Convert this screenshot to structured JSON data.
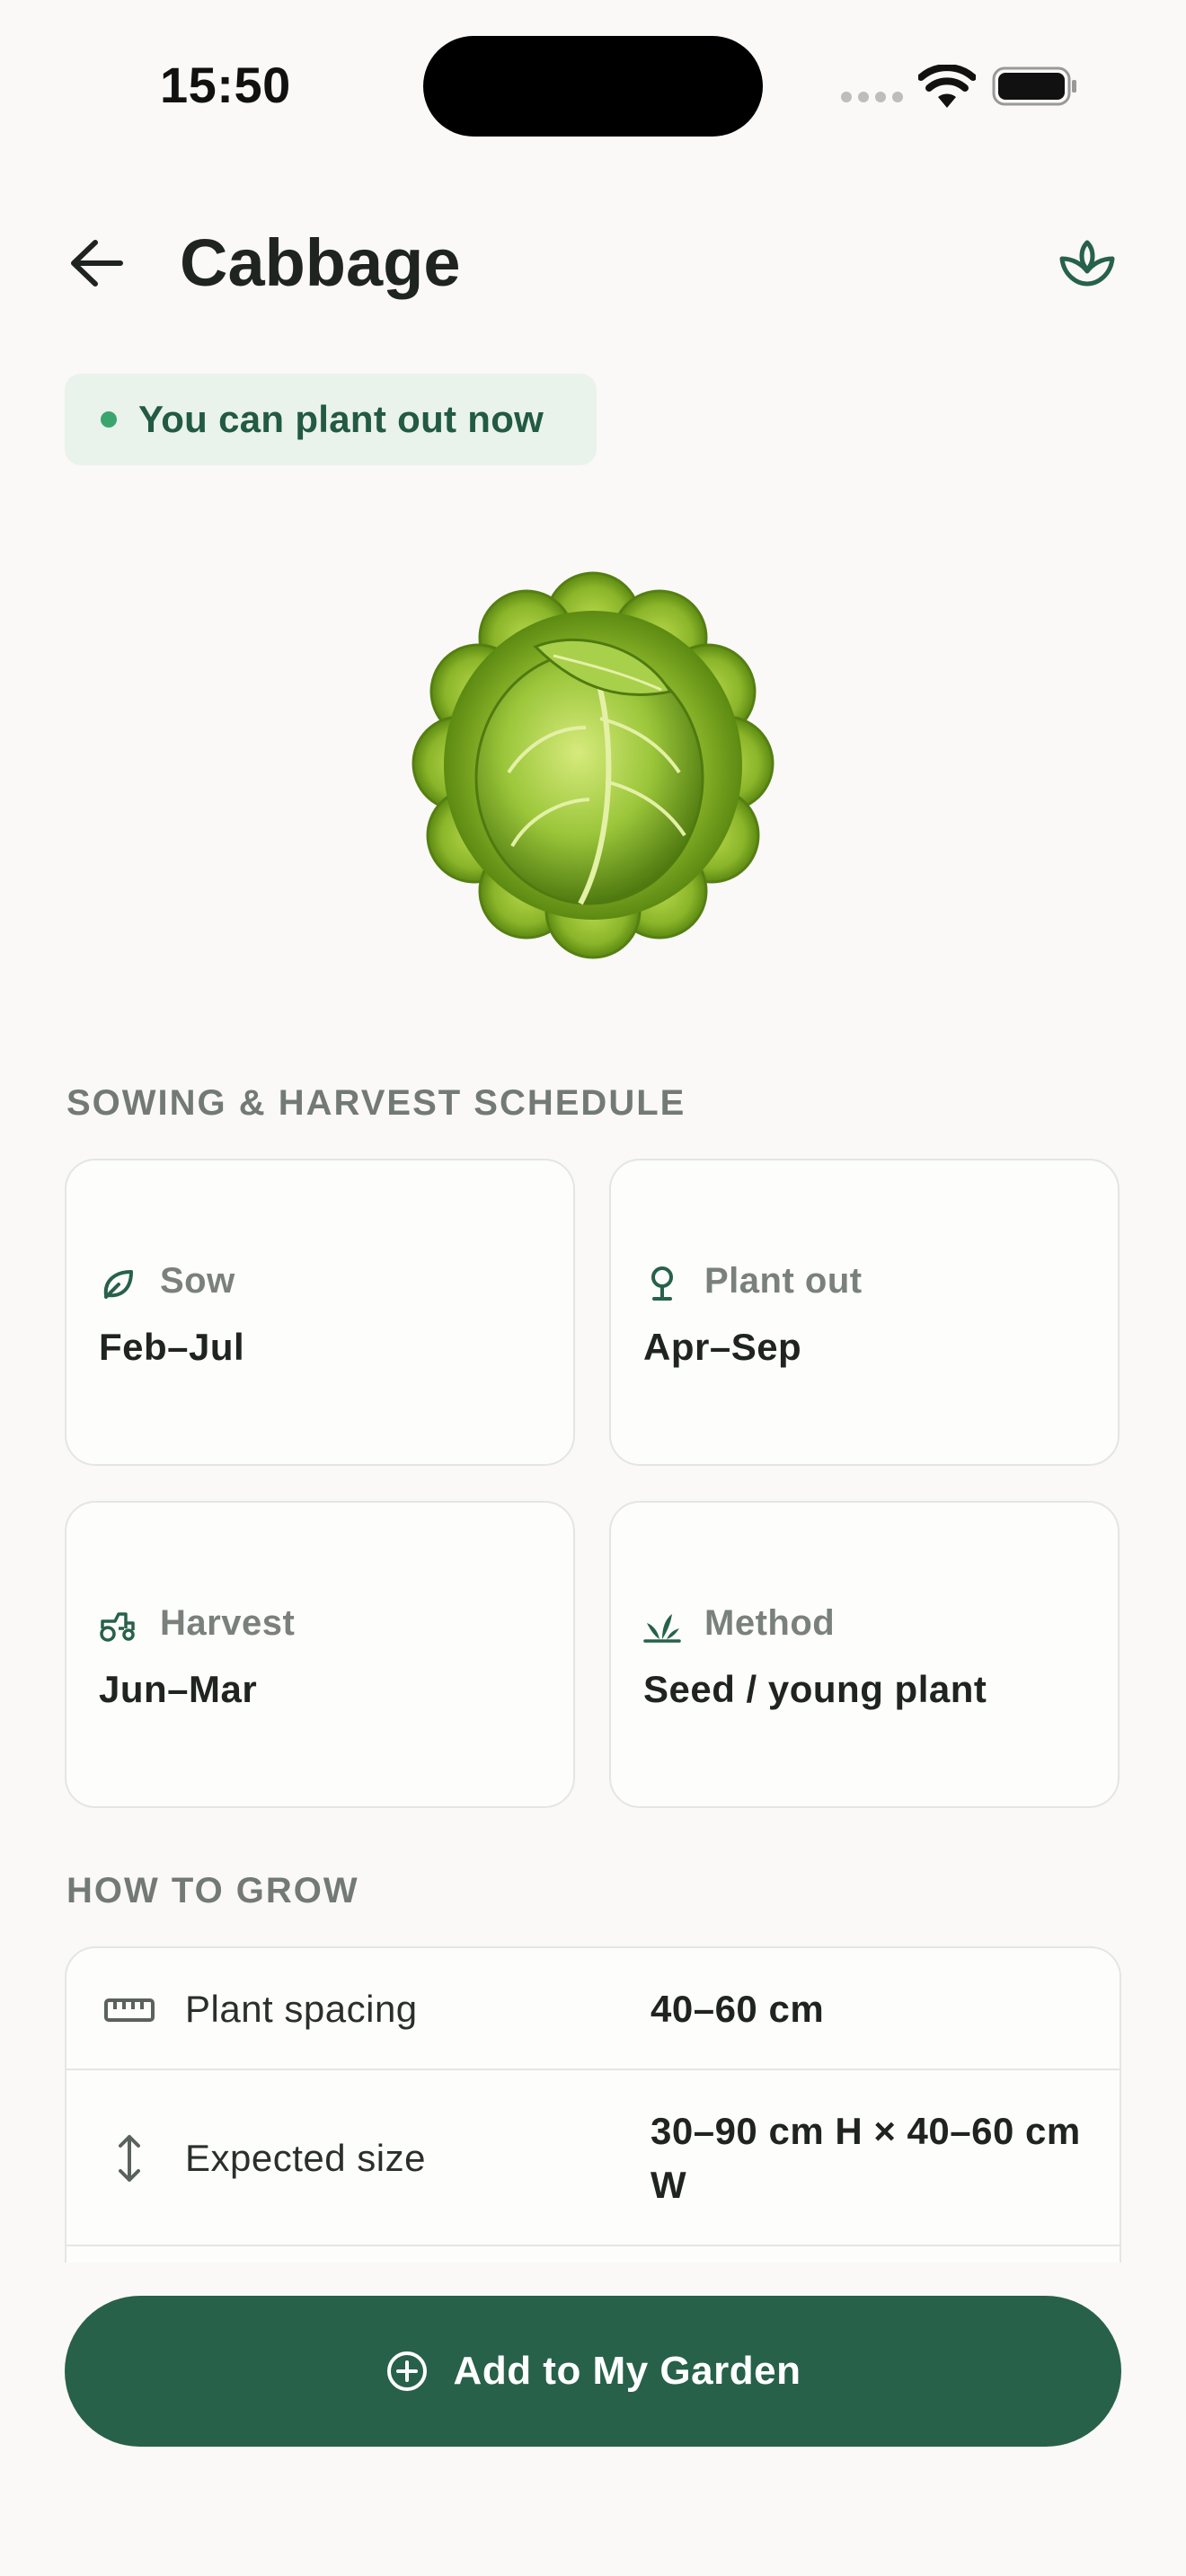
{
  "status_bar": {
    "time": "15:50"
  },
  "header": {
    "title": "Cabbage",
    "back_icon": "arrow-left-icon",
    "action_icon": "plant-sprout-icon"
  },
  "badge": {
    "text": "You can plant out now",
    "color": "#3aa66d"
  },
  "schedule": {
    "section_title": "SOWING & HARVEST SCHEDULE",
    "cards": [
      {
        "icon": "leaf-icon",
        "label": "Sow",
        "value": "Feb–Jul"
      },
      {
        "icon": "seedling-icon",
        "label": "Plant out",
        "value": "Apr–Sep"
      },
      {
        "icon": "tractor-icon",
        "label": "Harvest",
        "value": "Jun–Mar"
      },
      {
        "icon": "sprout-icon",
        "label": "Method",
        "value": "Seed / young plant"
      }
    ]
  },
  "grow": {
    "section_title": "HOW TO GROW",
    "rows": [
      {
        "icon": "ruler-icon",
        "label": "Plant spacing",
        "value": "40–60 cm"
      },
      {
        "icon": "vertical-arrows-icon",
        "label": "Expected size",
        "value": "30–90 cm H × 40–60 cm W"
      }
    ]
  },
  "cta": {
    "label": "Add to My Garden",
    "icon": "plus-circle-icon",
    "color": "#27614a"
  }
}
